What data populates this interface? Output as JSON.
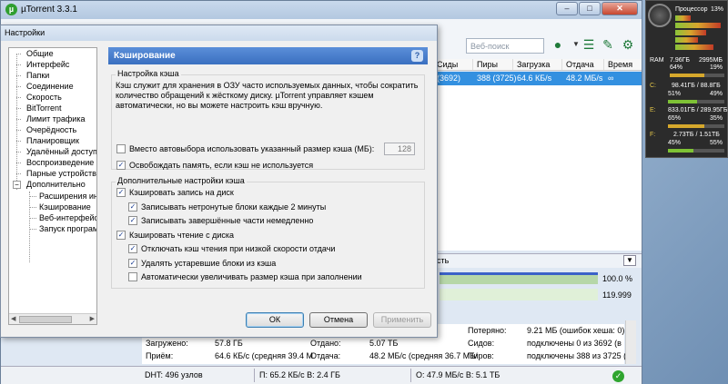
{
  "window": {
    "title": "µTorrent 3.3.1",
    "icon": "µ",
    "minimize": "–",
    "maximize": "□",
    "close": "✕"
  },
  "toolbar": {
    "search_placeholder": "Веб-поиск",
    "icons": [
      "globe-icon",
      "list-icon",
      "remote-icon",
      "gear-icon"
    ]
  },
  "torrent_list": {
    "columns": [
      "Сиды",
      "Пиры",
      "Загрузка",
      "Отдача",
      "Время"
    ],
    "row": [
      "(3692)",
      "388 (3725)",
      "64.6 КБ/s",
      "48.2 МБ/s",
      "∞"
    ]
  },
  "lower_panel": {
    "tab_fragment": "сть",
    "pct1": "100.0 %",
    "pct2": "119.999",
    "info": {
      "wasted_label": "Потеряно:",
      "wasted_value": "9.21 МБ (ошибок хеша: 0)",
      "downloaded_label": "Загружено:",
      "downloaded_value": "57.8 ГБ",
      "uploaded_label": "Отдано:",
      "uploaded_value": "5.07 ТБ",
      "seeds_label": "Сидов:",
      "seeds_value": "подключены 0 из 3692 (в",
      "dl_speed_label": "Приём:",
      "dl_speed_value": "64.6 КБ/с (средняя 39.4 М",
      "ul_speed_label": "Отдача:",
      "ul_speed_value": "48.2 МБ/с (средняя 36.7 МБ/",
      "peers_label": "Пиров:",
      "peers_value": "подключены 388 из 3725 ("
    }
  },
  "statusbar": {
    "dht": "DHT: 496 узлов",
    "down": "П: 65.2 КБ/с В: 2.4 ГБ",
    "up": "О: 47.9 МБ/с В: 5.1 ТБ",
    "ok_icon": "✓"
  },
  "dialog": {
    "title": "Настройки",
    "tree": [
      "Общие",
      "Интерфейс",
      "Папки",
      "Соединение",
      "Скорость",
      "BitTorrent",
      "Лимит трафика",
      "Очерёдность",
      "Планировщик",
      "Удалённый доступ",
      "Воспроизведение",
      "Парные устройства",
      "Дополнительно",
      "Расширения ин",
      "Кэширование",
      "Веб-интерфейс",
      "Запуск програм"
    ],
    "tree_expander": "−",
    "panel_title": "Кэширование",
    "help": "?",
    "group1_title": "Настройка кэша",
    "group1_desc": "Кэш служит для хранения в ОЗУ часто используемых данных, чтобы сократить количество обращений к жёсткому диску. µTorrent управляет кэшем автоматически, но вы можете настроить кэш вручную.",
    "cb_override": "Вместо автовыбора использовать указанный размер кэша (МБ):",
    "cache_size": "128",
    "cb_free_memory": "Освобождать память, если кэш не используется",
    "group2_title": "Дополнительные настройки кэша",
    "cb_write_cache": "Кэшировать запись на диск",
    "cb_write_untouched": "Записывать нетронутые блоки каждые 2 минуты",
    "cb_write_finished": "Записывать завершённые части немедленно",
    "cb_read_cache": "Кэшировать чтение с диска",
    "cb_turn_off_read": "Отключать кэш чтения при низкой скорости отдачи",
    "cb_remove_old": "Удалять устаревшие блоки из кэша",
    "cb_auto_increase": "Автоматически увеличивать размер кэша при заполнении",
    "check_mark": "✓",
    "ok": "ОК",
    "cancel": "Отмена",
    "apply": "Применить"
  },
  "gadget": {
    "cpu_label": "Процессор",
    "cpu_pct": "13%",
    "ram_label": "RAM",
    "ram_used": "7.96ГБ",
    "ram_total": "2995МБ",
    "ram_pct1": "64%",
    "ram_pct2": "19%",
    "c_letter": "C:",
    "c_sizes": "98.41ГБ / 88.8ГБ",
    "c_pct1": "51%",
    "c_pct2": "49%",
    "e_letter": "E:",
    "e_sizes": "833.01ГБ / 289.95ГБ",
    "e_pct1": "65%",
    "e_pct2": "35%",
    "f_letter": "F:",
    "f_sizes": "2.73ТБ / 1.51ТБ",
    "f_pct1": "45%",
    "f_pct2": "55%"
  }
}
